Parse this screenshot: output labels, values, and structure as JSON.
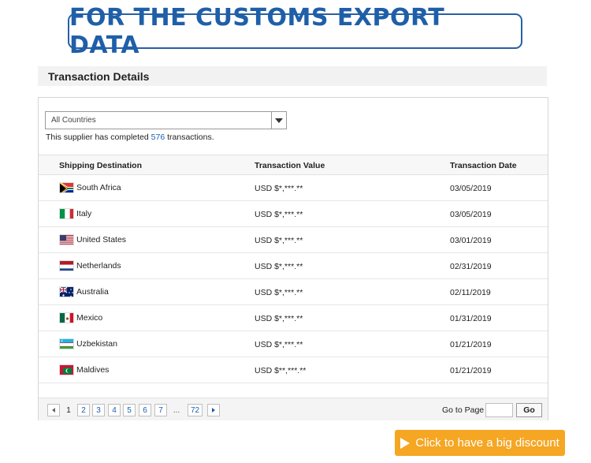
{
  "banner": {
    "title": "FOR THE CUSTOMS EXPORT DATA"
  },
  "section": {
    "title": "Transaction Details"
  },
  "filter": {
    "selected": "All Countries"
  },
  "summary": {
    "prefix": "This supplier has completed ",
    "count": "576",
    "suffix": " transactions."
  },
  "table": {
    "headers": {
      "destination": "Shipping Destination",
      "value": "Transaction Value",
      "date": "Transaction Date"
    },
    "rows": [
      {
        "country": "South Africa",
        "value": "USD $*,***.**",
        "date": "03/05/2019",
        "flag": "za-flag-icon"
      },
      {
        "country": "Italy",
        "value": "USD $*,***.**",
        "date": "03/05/2019",
        "flag": "it-flag-icon"
      },
      {
        "country": "United States",
        "value": "USD $*,***.**",
        "date": "03/01/2019",
        "flag": "us-flag-icon"
      },
      {
        "country": "Netherlands",
        "value": "USD $*,***.**",
        "date": "02/31/2019",
        "flag": "nl-flag-icon"
      },
      {
        "country": "Australia",
        "value": "USD $*,***.**",
        "date": "02/11/2019",
        "flag": "au-flag-icon"
      },
      {
        "country": "Mexico",
        "value": "USD $*,***.**",
        "date": "01/31/2019",
        "flag": "mx-flag-icon"
      },
      {
        "country": "Uzbekistan",
        "value": "USD $*,***.**",
        "date": "01/21/2019",
        "flag": "uz-flag-icon"
      },
      {
        "country": "Maldives",
        "value": "USD $**,***.**",
        "date": "01/21/2019",
        "flag": "mv-flag-icon"
      }
    ]
  },
  "pagination": {
    "current": "1",
    "pages": [
      "2",
      "3",
      "4",
      "5",
      "6",
      "7"
    ],
    "ellipsis": "...",
    "last": "72",
    "goto_label": "Go to Page",
    "goto_button": "Go"
  },
  "promo": {
    "label": "Click to have a big discount"
  },
  "colors": {
    "banner": "#1f5fa8",
    "link": "#1a5fb4",
    "promo": "#f5a623"
  }
}
